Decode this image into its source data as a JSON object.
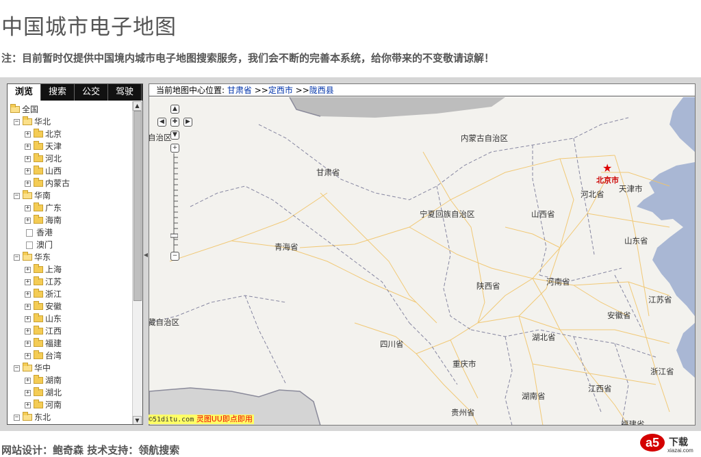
{
  "page": {
    "title": "中国城市电子地图",
    "notice": "注：目前暂时仅提供中国境内城市电子地图搜索服务，我们会不断的完善本系统，给你带来的不变敬请谅解！",
    "footer": "网站设计：鲍奇森  技术支持：领航搜索"
  },
  "tabs": [
    {
      "label": "浏览",
      "active": true
    },
    {
      "label": "搜索",
      "active": false
    },
    {
      "label": "公交",
      "active": false
    },
    {
      "label": "驾驶",
      "active": false
    }
  ],
  "tree": [
    {
      "label": "全国",
      "level": 0,
      "type": "folder-open",
      "toggle": ""
    },
    {
      "label": "华北",
      "level": 1,
      "type": "folder-open",
      "toggle": "−"
    },
    {
      "label": "北京",
      "level": 2,
      "type": "folder",
      "toggle": "+"
    },
    {
      "label": "天津",
      "level": 2,
      "type": "folder",
      "toggle": "+"
    },
    {
      "label": "河北",
      "level": 2,
      "type": "folder",
      "toggle": "+"
    },
    {
      "label": "山西",
      "level": 2,
      "type": "folder",
      "toggle": "+"
    },
    {
      "label": "内蒙古",
      "level": 2,
      "type": "folder",
      "toggle": "+"
    },
    {
      "label": "华南",
      "level": 1,
      "type": "folder-open",
      "toggle": "−"
    },
    {
      "label": "广东",
      "level": 2,
      "type": "folder",
      "toggle": "+"
    },
    {
      "label": "海南",
      "level": 2,
      "type": "folder",
      "toggle": "+"
    },
    {
      "label": "香港",
      "level": 2,
      "type": "doc",
      "toggle": ""
    },
    {
      "label": "澳门",
      "level": 2,
      "type": "doc",
      "toggle": ""
    },
    {
      "label": "华东",
      "level": 1,
      "type": "folder-open",
      "toggle": "−"
    },
    {
      "label": "上海",
      "level": 2,
      "type": "folder",
      "toggle": "+"
    },
    {
      "label": "江苏",
      "level": 2,
      "type": "folder",
      "toggle": "+"
    },
    {
      "label": "浙江",
      "level": 2,
      "type": "folder",
      "toggle": "+"
    },
    {
      "label": "安徽",
      "level": 2,
      "type": "folder",
      "toggle": "+"
    },
    {
      "label": "山东",
      "level": 2,
      "type": "folder",
      "toggle": "+"
    },
    {
      "label": "江西",
      "level": 2,
      "type": "folder",
      "toggle": "+"
    },
    {
      "label": "福建",
      "level": 2,
      "type": "folder",
      "toggle": "+"
    },
    {
      "label": "台湾",
      "level": 2,
      "type": "folder",
      "toggle": "+"
    },
    {
      "label": "华中",
      "level": 1,
      "type": "folder-open",
      "toggle": "−"
    },
    {
      "label": "湖南",
      "level": 2,
      "type": "folder",
      "toggle": "+"
    },
    {
      "label": "湖北",
      "level": 2,
      "type": "folder",
      "toggle": "+"
    },
    {
      "label": "河南",
      "level": 2,
      "type": "folder",
      "toggle": "+"
    },
    {
      "label": "东北",
      "level": 1,
      "type": "folder-open",
      "toggle": "−"
    }
  ],
  "crumb": {
    "prefix": "当前地图中心位置:",
    "province": "甘肃省",
    "sep": ">>",
    "city": "定西市",
    "county": "陇西县"
  },
  "map": {
    "labels": {
      "gansu": "甘肃省",
      "qinghai": "青海省",
      "neimenggu": "内蒙古自治区",
      "ningxia": "宁夏回族自治区",
      "shanxi": "山西省",
      "hebei": "河北省",
      "tianjin": "天津市",
      "shandong": "山东省",
      "shaanxi": "陕西省",
      "henan": "河南省",
      "jiangsu": "江苏省",
      "anhui": "安徽省",
      "xizang": "藏自治区",
      "sichuan": "四川省",
      "hubei": "湖北省",
      "chongqing": "重庆市",
      "zhejiang": "浙江省",
      "hunan": "湖南省",
      "jiangxi": "江西省",
      "guizhou": "贵州省",
      "fujian": "福建省",
      "xinjiang": "自治区"
    },
    "capital": "北京市",
    "copyright_a": "©51ditu.com",
    "copyright_b": "灵图UU即点即用",
    "colors": {
      "land": "#f3f2ee",
      "water": "#a8b8d8",
      "road": "#f0c060",
      "border": "#7a7a8a"
    }
  },
  "logo": {
    "mark": "a5",
    "text": "下载",
    "site": "xiazai.com"
  }
}
